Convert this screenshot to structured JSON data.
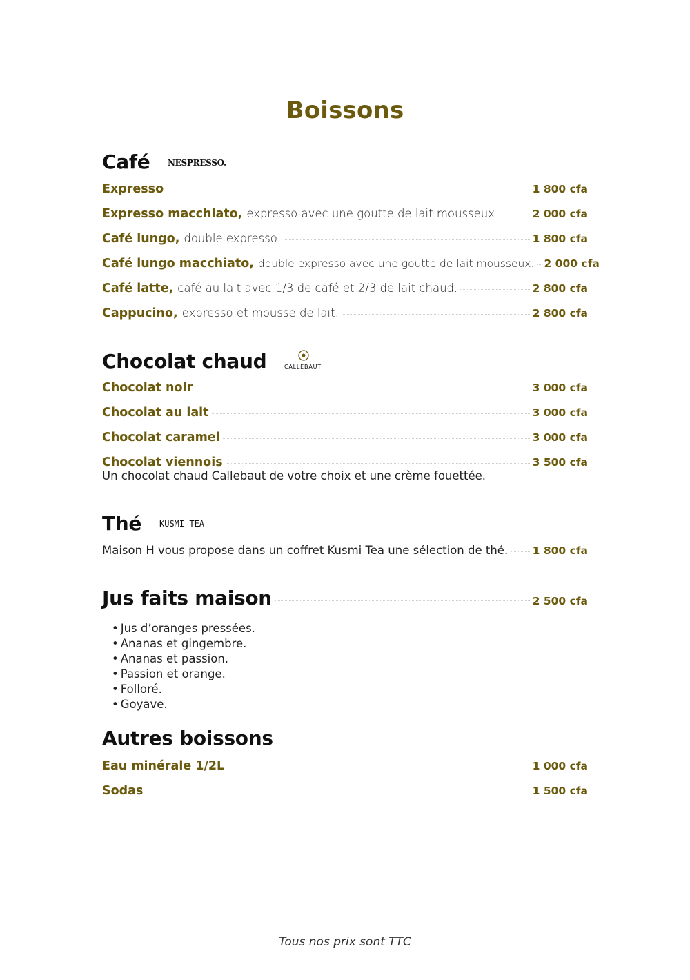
{
  "title": "Boissons",
  "sections": {
    "cafe": {
      "title": "Café",
      "brand": "NESPRESSO.",
      "items": [
        {
          "name": "Expresso",
          "desc": "",
          "price": "1 800 cfa"
        },
        {
          "name": "Expresso macchiato,",
          "desc": "expresso avec une goutte de lait mousseux.",
          "price": "2 000 cfa"
        },
        {
          "name": "Café lungo,",
          "desc": "double expresso.",
          "price": "1 800 cfa"
        },
        {
          "name": "Café lungo macchiato,",
          "desc": "double expresso avec une goutte de lait mousseux.",
          "price": "2 000 cfa"
        },
        {
          "name": "Café latte,",
          "desc": "café au lait avec 1/3 de café et 2/3 de lait chaud.",
          "price": "2 800 cfa"
        },
        {
          "name": "Cappucino,",
          "desc": "expresso et mousse de lait.",
          "price": "2 800 cfa"
        }
      ]
    },
    "chocolat": {
      "title": "Chocolat chaud",
      "brand": "CALLEBAUT",
      "items": [
        {
          "name": "Chocolat noir",
          "price": "3 000 cfa"
        },
        {
          "name": "Chocolat au lait",
          "price": "3 000 cfa"
        },
        {
          "name": "Chocolat caramel",
          "price": "3 000 cfa"
        },
        {
          "name": "Chocolat viennois",
          "price": "3 500 cfa"
        }
      ],
      "note": "Un chocolat chaud Callebaut de votre choix et une crème fouettée."
    },
    "the": {
      "title": "Thé",
      "brand": "KUSMI TEA",
      "text": "Maison H vous propose dans un coffret Kusmi Tea une sélection de thé.",
      "price": "1 800 cfa"
    },
    "jus": {
      "title": "Jus faits maison",
      "price": "2 500 cfa",
      "items": [
        "Jus d’oranges pressées.",
        "Ananas et gingembre.",
        "Ananas et passion.",
        "Passion et orange.",
        "Folloré.",
        "Goyave."
      ]
    },
    "autres": {
      "title": "Autres boissons",
      "items": [
        {
          "name": "Eau minérale 1/2L",
          "price": "1 000 cfa"
        },
        {
          "name": "Sodas",
          "price": "1 500 cfa"
        }
      ]
    }
  },
  "footer": "Tous nos prix sont TTC",
  "colors": {
    "accent": "#6b5a0e",
    "heading": "#111111",
    "body": "#222222",
    "leader": "#d0d0d0"
  }
}
